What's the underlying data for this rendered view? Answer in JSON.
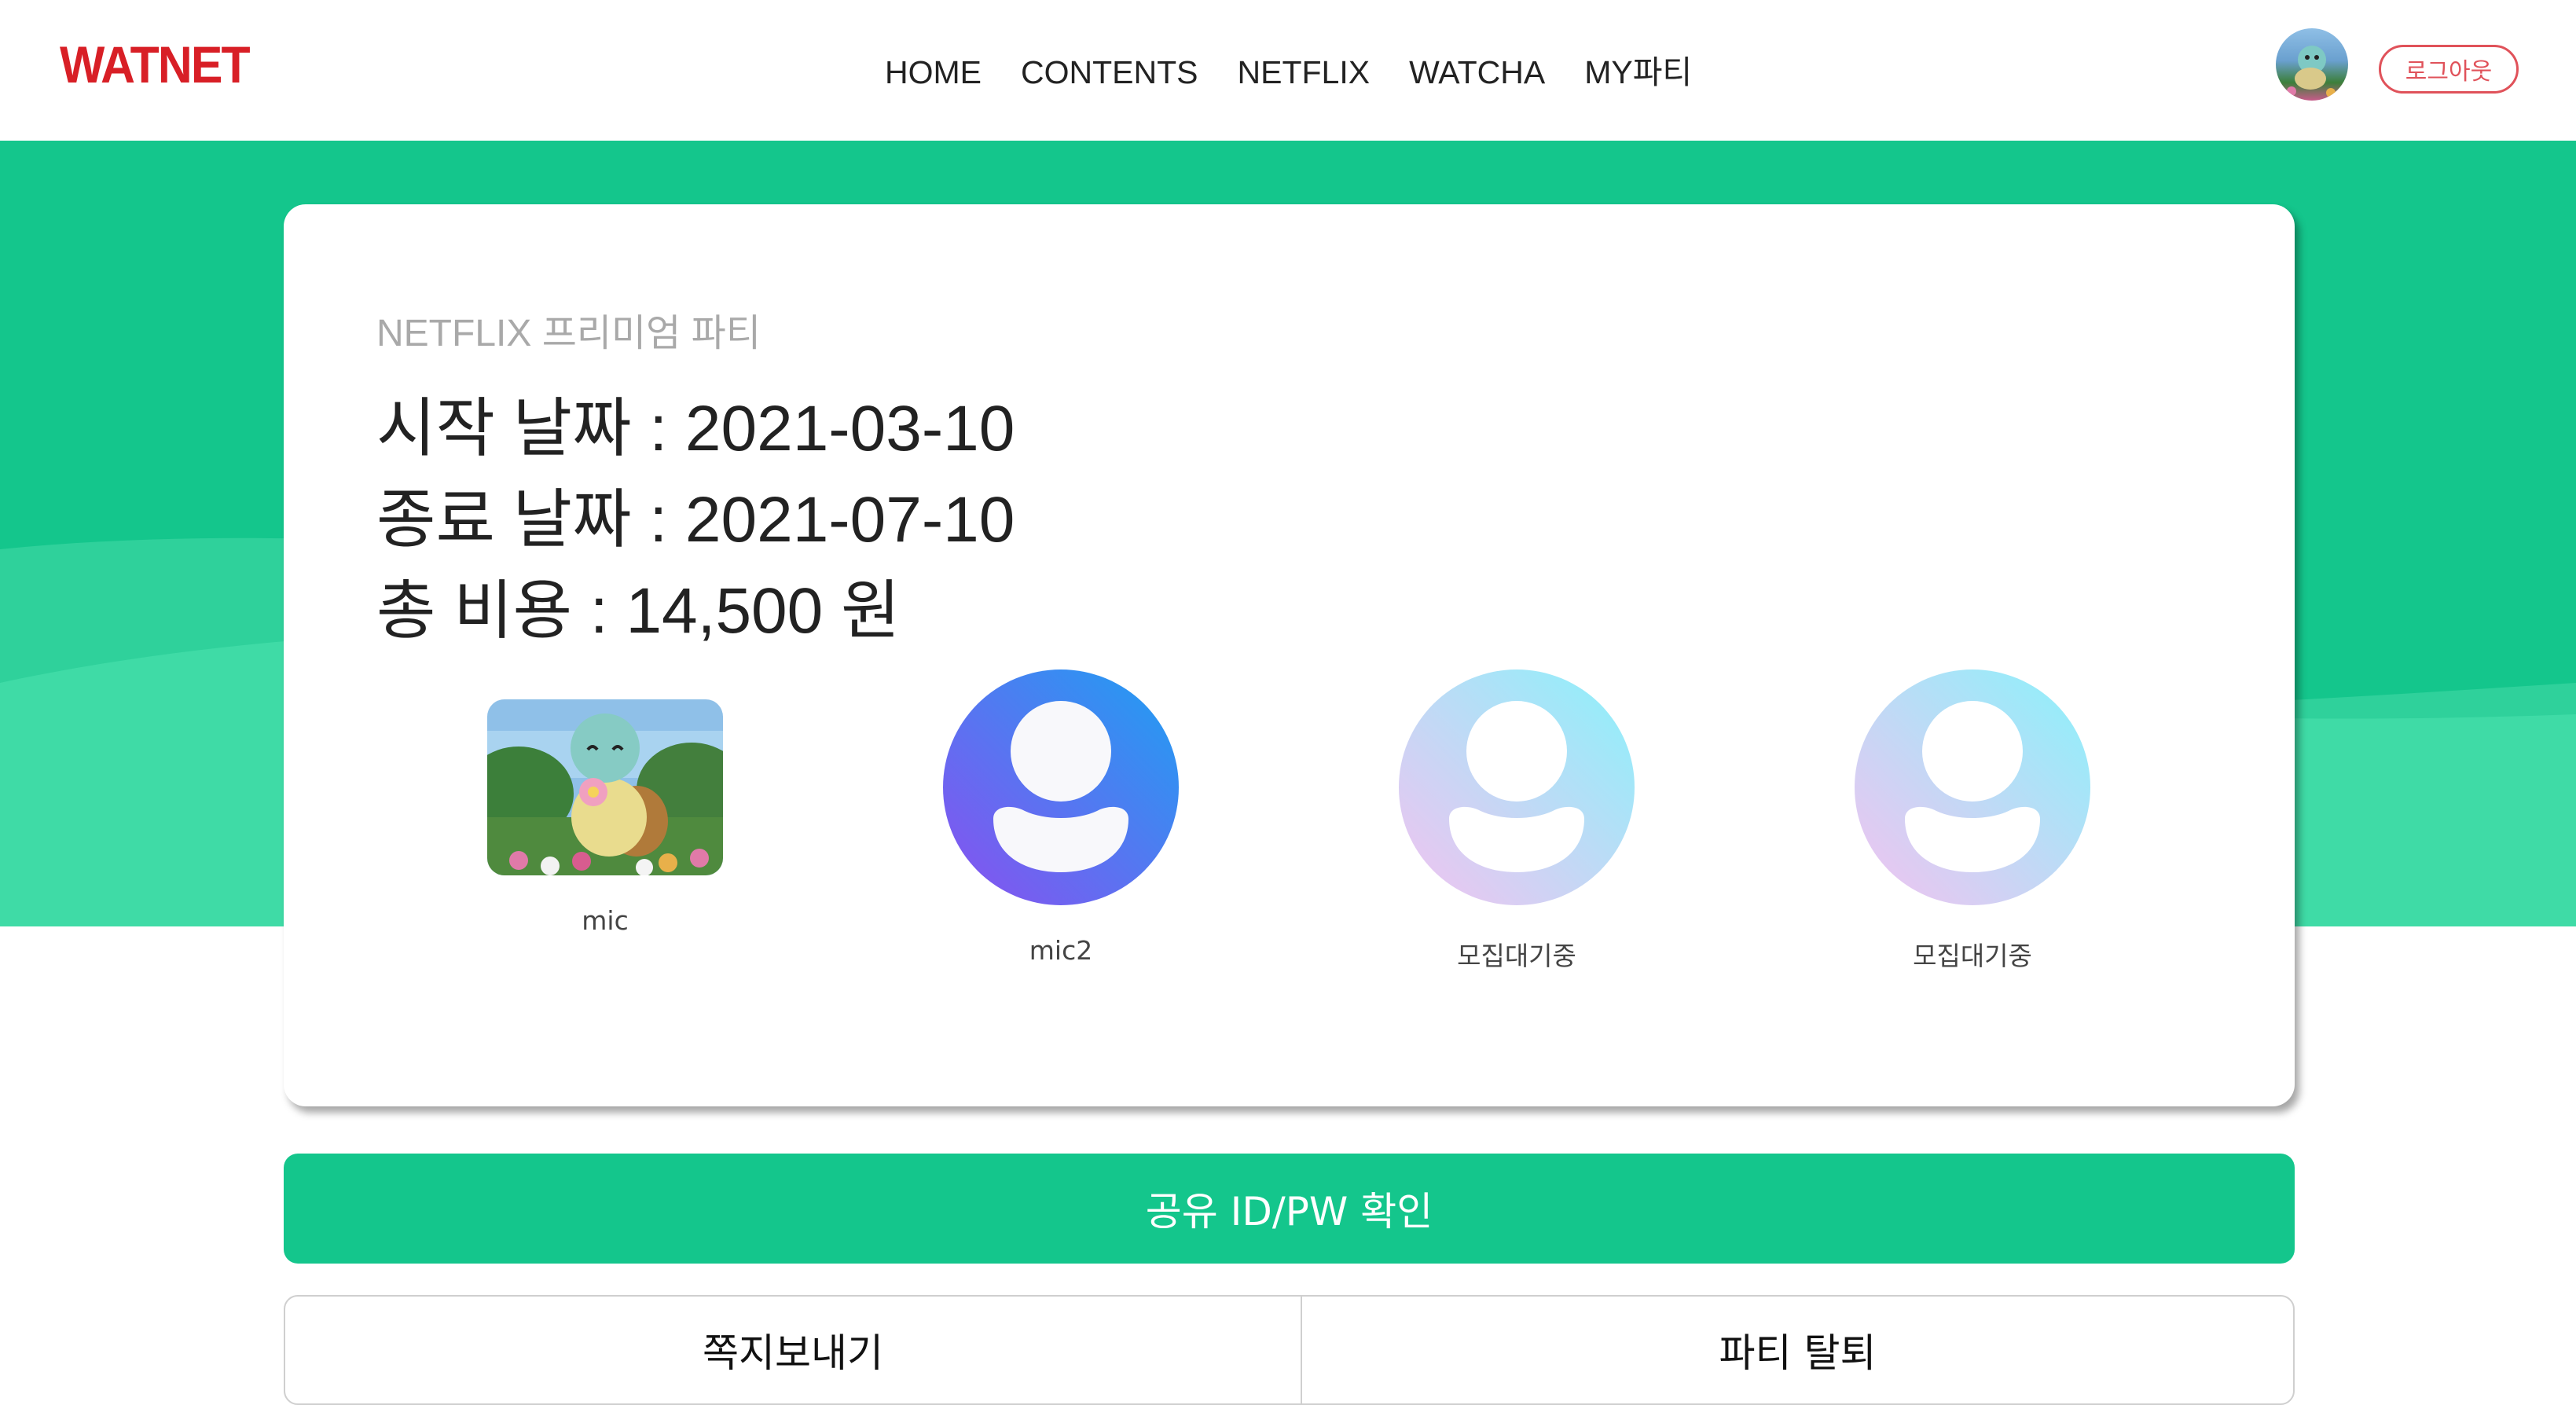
{
  "header": {
    "logo": "WATNET",
    "nav": [
      "HOME",
      "CONTENTS",
      "NETFLIX",
      "WATCHA",
      "MY파티"
    ],
    "logout_label": "로그아웃"
  },
  "party": {
    "subtitle": "NETFLIX 프리미엄 파티",
    "start": "시작 날짜 : 2021-03-10",
    "end": "종료 날짜 : 2021-07-10",
    "cost": "총 비용 : 14,500 원"
  },
  "members": [
    {
      "name": "mic",
      "avatar": "squirtle-photo"
    },
    {
      "name": "mic2",
      "avatar": "default-user-icon"
    },
    {
      "name": "모집대기중",
      "avatar": "empty-slot-icon"
    },
    {
      "name": "모집대기중",
      "avatar": "empty-slot-icon"
    }
  ],
  "actions": {
    "share_label": "공유 ID/PW 확인",
    "message_label": "쪽지보내기",
    "leave_label": "파티 탈퇴"
  },
  "colors": {
    "brand_red": "#d81f26",
    "accent_green": "#14c68c",
    "wave_green": "#3fdba6"
  }
}
